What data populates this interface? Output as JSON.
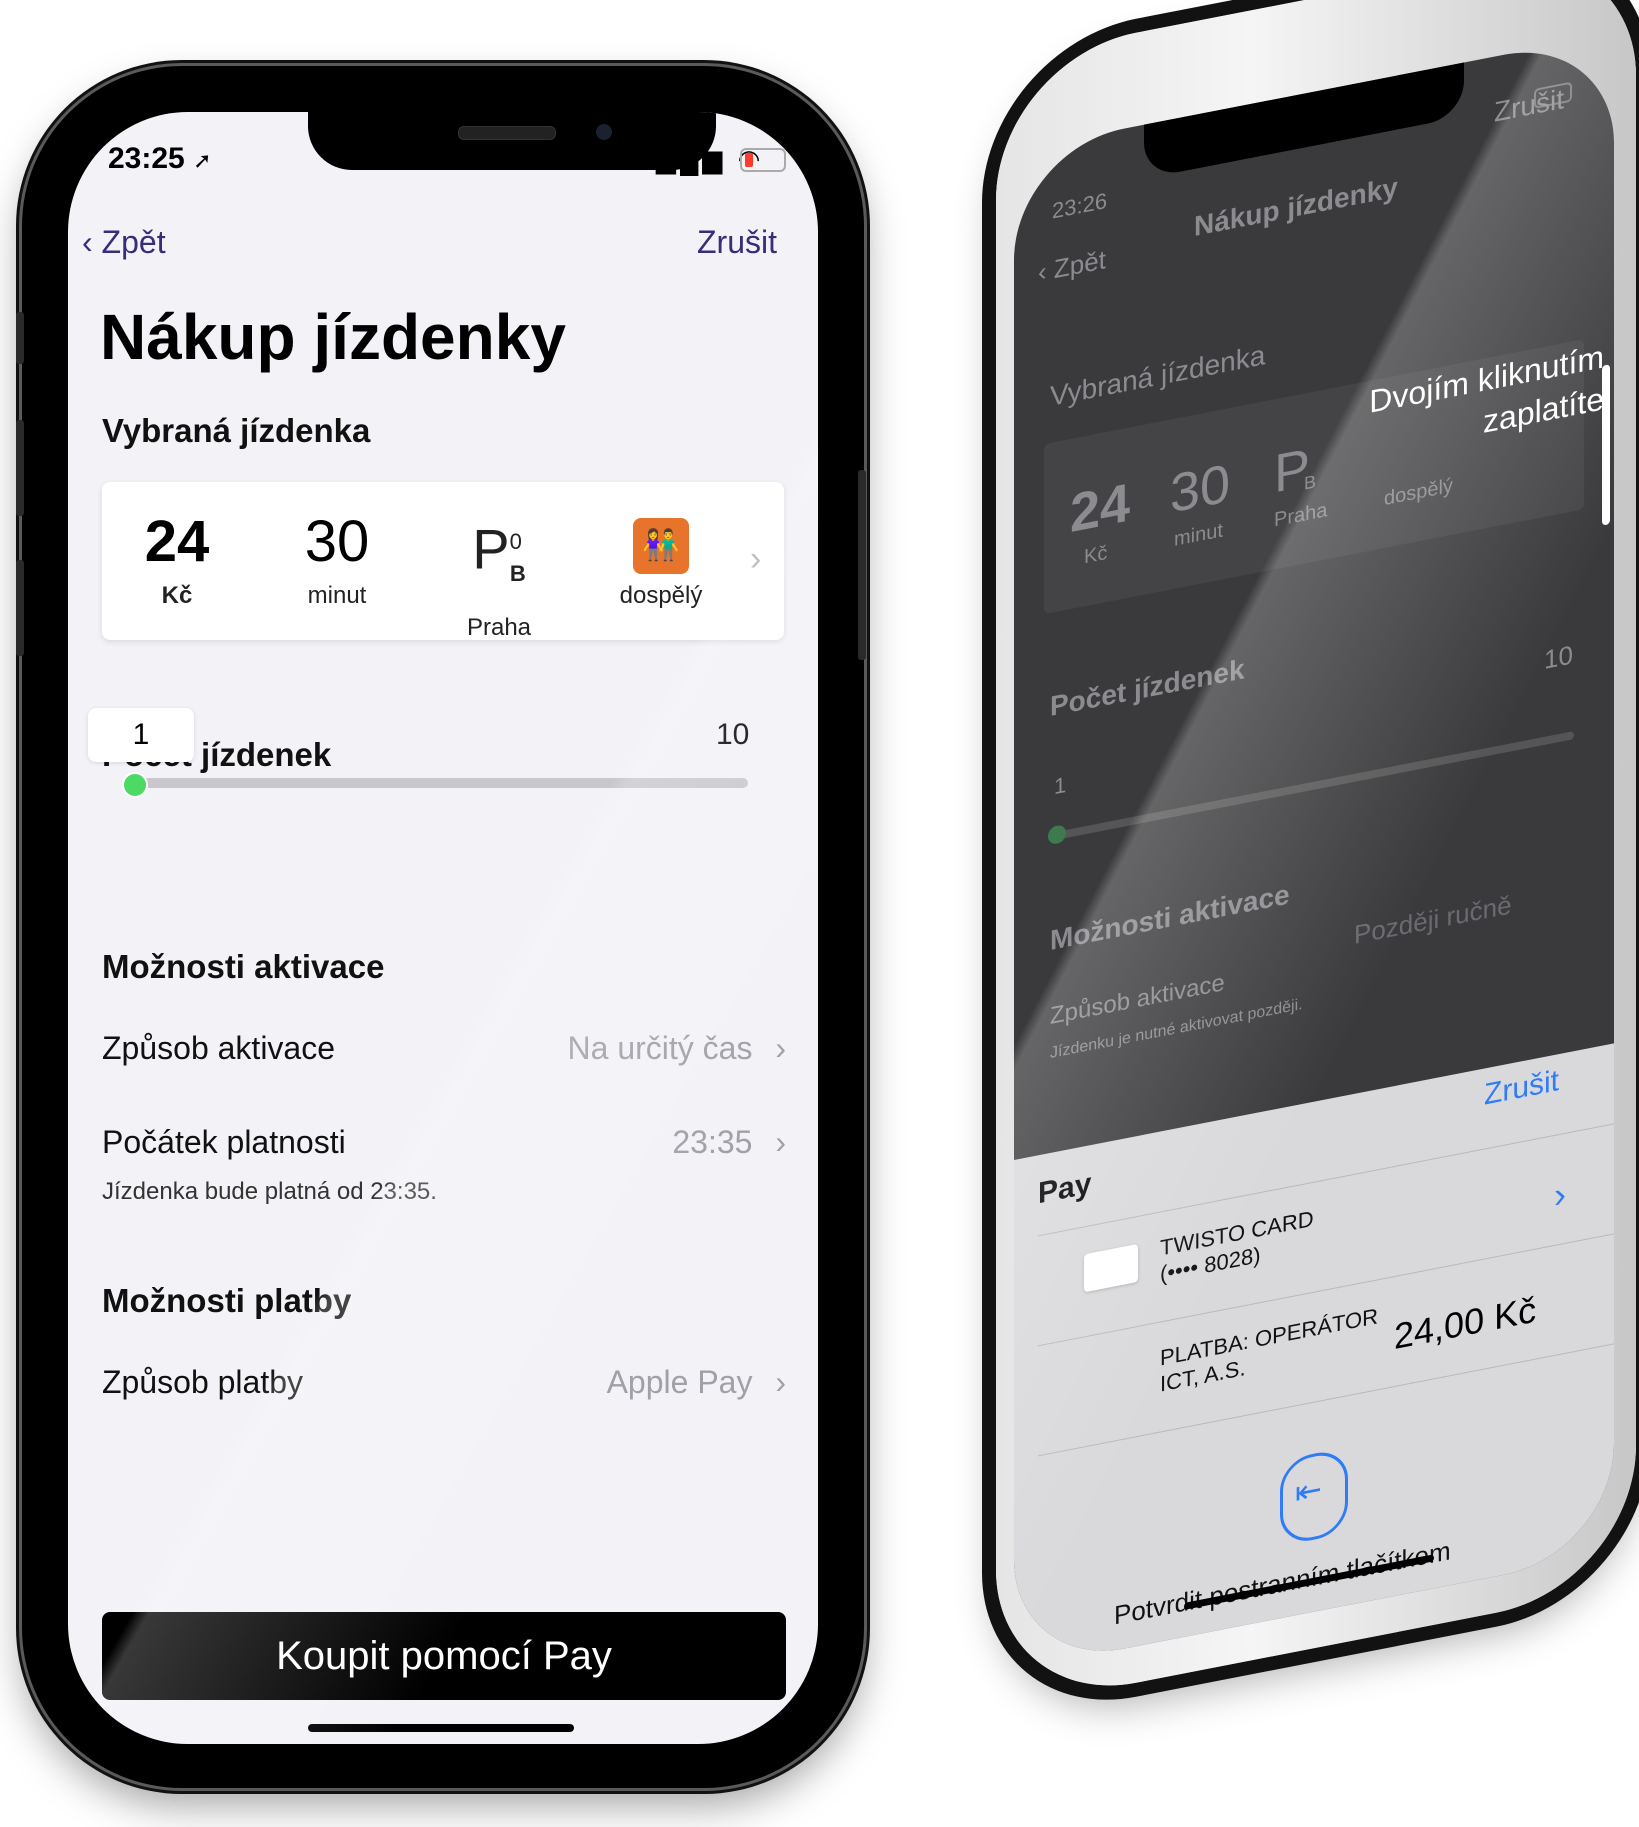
{
  "phone1": {
    "status": {
      "time": "23:25",
      "signal": "▂▄▆",
      "wifi": "◠"
    },
    "nav": {
      "back": "‹ Zpět",
      "cancel": "Zrušit"
    },
    "title": "Nákup jízdenky",
    "selected_ticket": {
      "heading": "Vybraná jízdenka",
      "price_value": "24",
      "price_unit": "Kč",
      "duration_value": "30",
      "duration_unit": "minut",
      "zone_letter": "P",
      "zone_sup": "0",
      "zone_sub": "B",
      "zone_label": "Praha",
      "passenger_label": "dospělý",
      "chevron": "›"
    },
    "count": {
      "heading": "Počet jízdenek",
      "min_value": "1",
      "max_label": "10",
      "selected": 1,
      "max": 10
    },
    "activation": {
      "heading": "Možnosti aktivace",
      "method_label": "Způsob aktivace",
      "method_value": "Na určitý čas",
      "start_label": "Počátek platnosti",
      "start_value": "23:35",
      "start_note": "Jízdenka bude platná od 23:35.",
      "chevron": "›"
    },
    "payment": {
      "heading": "Možnosti platby",
      "method_label": "Způsob platby",
      "method_value": "Apple Pay",
      "chevron": "›"
    },
    "buy_button": "Koupit pomocí  Pay"
  },
  "phone2": {
    "status_time": "23:26",
    "nav_back": "‹ Zpět",
    "nav_title": "Nákup jízdenky",
    "nav_cancel": "Zrušit",
    "selected_heading": "Vybraná jízdenka",
    "price_value": "24",
    "price_unit": "Kč",
    "duration_value": "30",
    "duration_unit": "minut",
    "zone_letter": "P",
    "zone_sub": "B",
    "zone_label": "Praha",
    "passenger_label": "dospělý",
    "voiceover": "Dvojím kliknutím zaplatíte",
    "count_heading": "Počet jízdenek",
    "count_min": "1",
    "count_max": "10",
    "activation_heading": "Možnosti aktivace",
    "activation_label": "Způsob aktivace",
    "activation_value": "Později ručně",
    "activation_note": "Jízdenku je nutné aktivovat později.",
    "apple_pay": {
      "logo": " Pay",
      "cancel": "Zrušit",
      "card_name": "TWISTO CARD",
      "card_number": "(•••• 8028)",
      "chevron": "›",
      "merchant_line1": "PLATBA: OPERÁTOR",
      "merchant_line2": "ICT, A.S.",
      "amount": "24,00 Kč",
      "confirm": "Potvrdit postranním tlačítkem"
    }
  },
  "colors": {
    "accent_nav": "#3a2c7a",
    "slider_thumb": "#4cd964",
    "passenger_icon": "#e8742c",
    "apple_pay_blue": "#2f7cf6"
  },
  "icons": [
    "back-chevron-icon",
    "chevron-right-icon",
    "passenger-icon",
    "apple-logo-icon",
    "side-button-icon",
    "wifi-icon",
    "signal-icon",
    "battery-icon",
    "location-arrow-icon"
  ]
}
